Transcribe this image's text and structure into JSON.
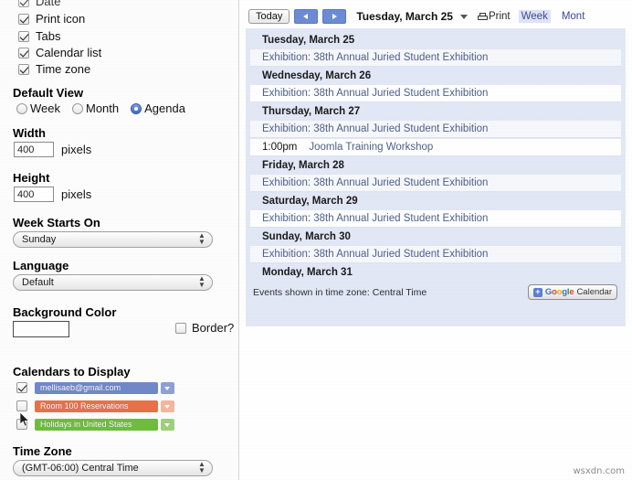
{
  "config_panel": {
    "checkbox_options": [
      {
        "label": "Date",
        "checked": true,
        "partially_visible": true
      },
      {
        "label": "Print icon",
        "checked": true
      },
      {
        "label": "Tabs",
        "checked": true
      },
      {
        "label": "Calendar list",
        "checked": true
      },
      {
        "label": "Time zone",
        "checked": true
      }
    ],
    "default_view": {
      "title": "Default View",
      "options": [
        {
          "label": "Week",
          "selected": false
        },
        {
          "label": "Month",
          "selected": false
        },
        {
          "label": "Agenda",
          "selected": true
        }
      ]
    },
    "width": {
      "title": "Width",
      "value": "400",
      "unit": "pixels"
    },
    "height": {
      "title": "Height",
      "value": "400",
      "unit": "pixels"
    },
    "week_starts_on": {
      "title": "Week Starts On",
      "value": "Sunday"
    },
    "language": {
      "title": "Language",
      "value": "Default"
    },
    "background_color": {
      "title": "Background Color",
      "value": "#ffffff"
    },
    "border": {
      "label": "Border?",
      "checked": false
    },
    "calendars_to_display": {
      "title": "Calendars to Display",
      "items": [
        {
          "name": "mellisaeb@gmail.com",
          "checked": true,
          "color": "#7188c9"
        },
        {
          "name": "Room 100 Reservations",
          "checked": false,
          "color": "#e8714a"
        },
        {
          "name": "Holidays in United States",
          "checked": false,
          "color": "#6fbd3c"
        }
      ]
    },
    "time_zone": {
      "title": "Time Zone",
      "value": "(GMT-06:00) Central Time"
    }
  },
  "calendar_preview": {
    "toolbar": {
      "today_label": "Today",
      "prev_label": "◀",
      "next_label": "▶",
      "current_range": "Tuesday, March 25",
      "print_label": "Print",
      "views": [
        "Week",
        "Mont"
      ]
    },
    "agenda": [
      {
        "type": "day",
        "label": "Tuesday, March 25"
      },
      {
        "type": "event",
        "time": "",
        "title": "Exhibition: 38th Annual Juried Student Exhibition"
      },
      {
        "type": "day",
        "label": "Wednesday, March 26"
      },
      {
        "type": "event",
        "time": "",
        "title": "Exhibition: 38th Annual Juried Student Exhibition"
      },
      {
        "type": "day",
        "label": "Thursday, March 27"
      },
      {
        "type": "event",
        "time": "",
        "title": "Exhibition: 38th Annual Juried Student Exhibition"
      },
      {
        "type": "event-timed",
        "time": "1:00pm",
        "title": "Joomla Training Workshop"
      },
      {
        "type": "day",
        "label": "Friday, March 28"
      },
      {
        "type": "event",
        "time": "",
        "title": "Exhibition: 38th Annual Juried Student Exhibition"
      },
      {
        "type": "day",
        "label": "Saturday, March 29"
      },
      {
        "type": "event",
        "time": "",
        "title": "Exhibition: 38th Annual Juried Student Exhibition"
      },
      {
        "type": "day",
        "label": "Sunday, March 30"
      },
      {
        "type": "event",
        "time": "",
        "title": "Exhibition: 38th Annual Juried Student Exhibition"
      },
      {
        "type": "day",
        "label": "Monday, March 31"
      }
    ],
    "footer": {
      "timezone_note": "Events shown in time zone: Central Time",
      "google_calendar_label": "Calendar",
      "google_wordmark": "Google",
      "plus_label": "+"
    }
  },
  "watermark": "wsxdn.com"
}
